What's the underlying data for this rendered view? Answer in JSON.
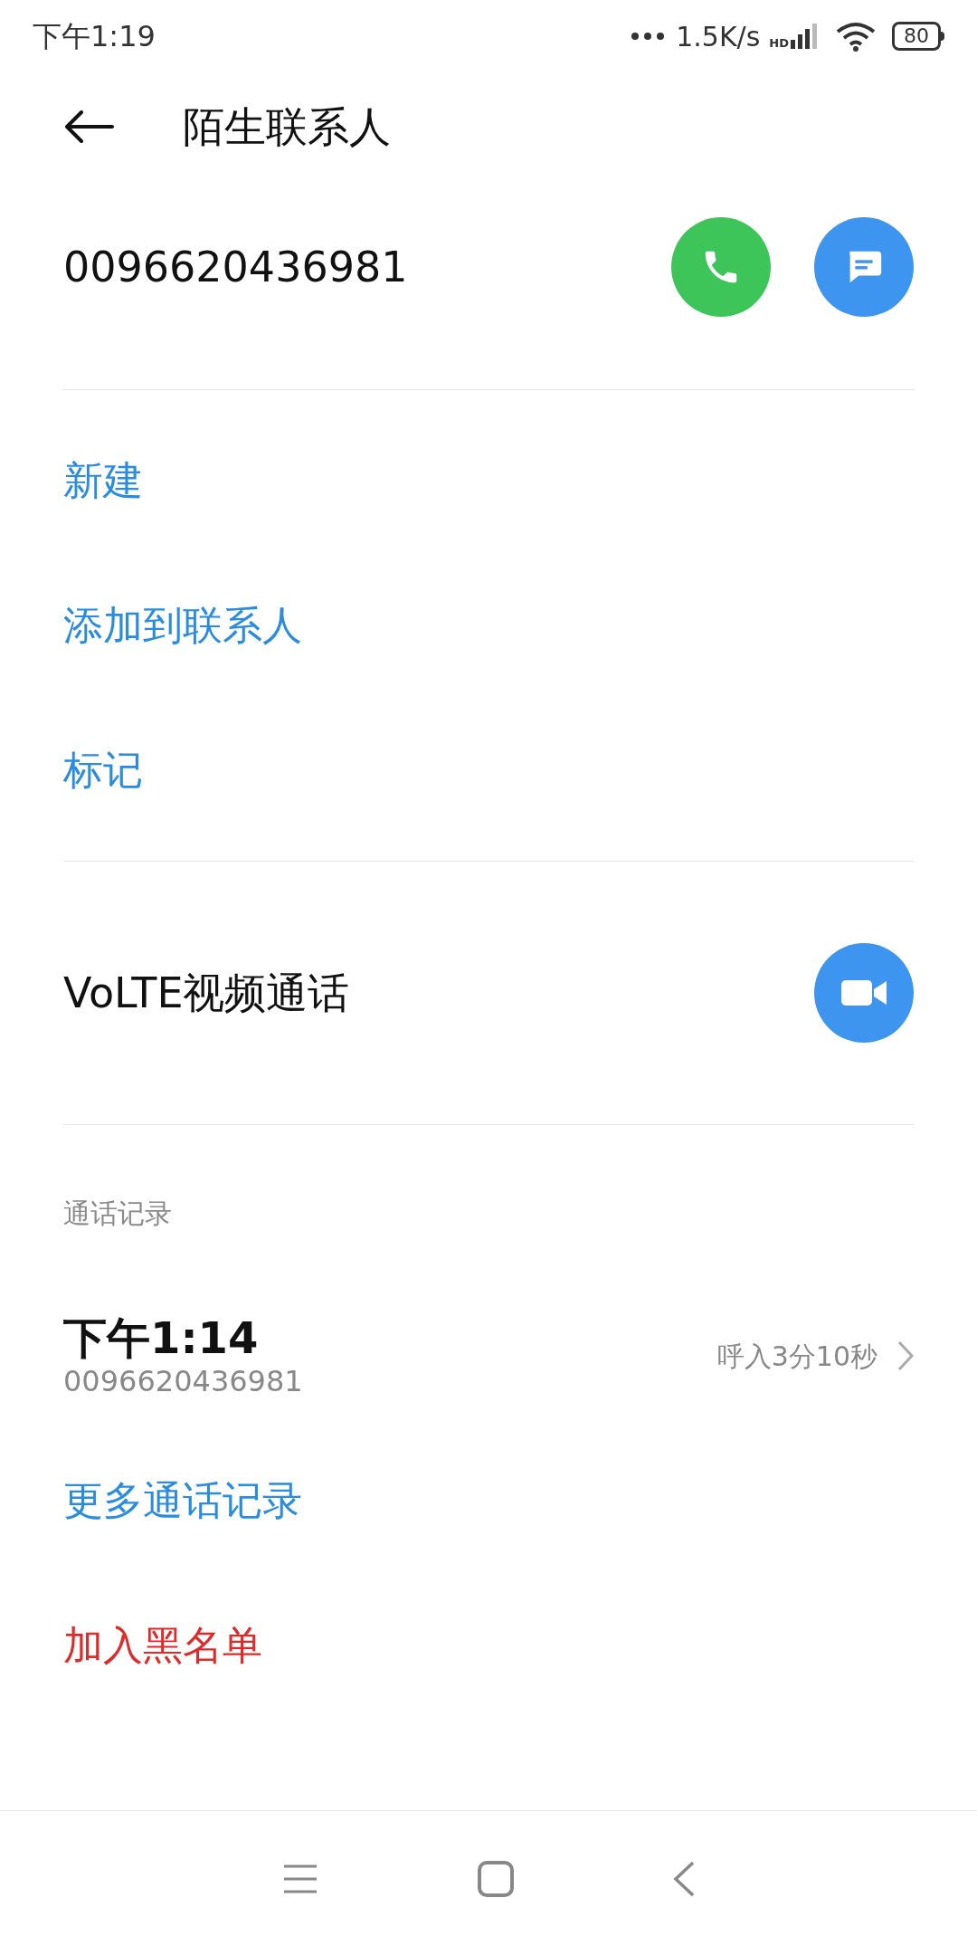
{
  "status_bar": {
    "time": "下午1:19",
    "network_speed": "1.5K/s",
    "network_type": "HD",
    "battery": "80"
  },
  "header": {
    "title": "陌生联系人"
  },
  "contact": {
    "number": "0096620436981"
  },
  "actions": [
    {
      "label": "新建",
      "kind": "normal"
    },
    {
      "label": "添加到联系人",
      "kind": "normal"
    },
    {
      "label": "标记",
      "kind": "normal"
    }
  ],
  "video_call": {
    "label": "VoLTE视频通话"
  },
  "call_log": {
    "heading": "通话记录",
    "entries": [
      {
        "time": "下午1:14",
        "number": "0096620436981",
        "detail": "呼入3分10秒"
      }
    ]
  },
  "bottom_actions": [
    {
      "label": "更多通话记录",
      "kind": "normal"
    },
    {
      "label": "加入黑名单",
      "kind": "danger"
    }
  ]
}
